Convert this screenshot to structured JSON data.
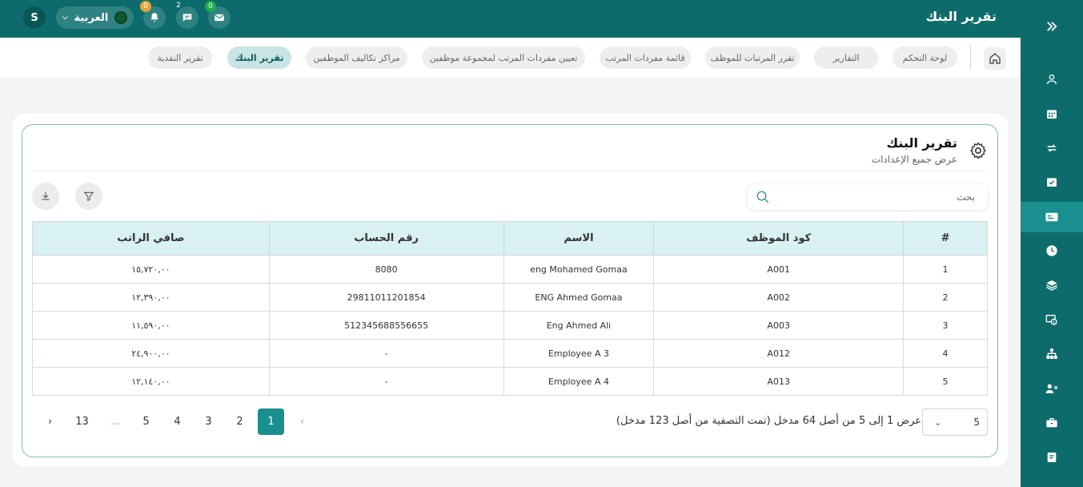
{
  "header": {
    "title": "تقرير البنك",
    "user_initial": "S",
    "language": "العربية",
    "notifications_count": "0",
    "chat_count": "2",
    "mail_count": "0"
  },
  "breadcrumbs": [
    "لوحة التحكم",
    "التقارير",
    "تقرر المرتبات للموظف",
    "قائمة مفردات المرتب",
    "تعيين مفردات المرتب لمجموعة موظفين",
    "مراكز تكاليف الموظفين",
    "تقرير البنك",
    "تقرير النقدية"
  ],
  "card": {
    "title": "تقرير البنك",
    "subtitle": "عرض جميع الإعدادات",
    "search_placeholder": "بحث"
  },
  "table": {
    "headers": [
      "#",
      "كود الموظف",
      "الاسم",
      "رقم الحساب",
      "صافي الراتب"
    ],
    "rows": [
      [
        "1",
        "A001",
        "eng Mohamed Gomaa",
        "8080",
        "١٥,٧٢٠,٠٠"
      ],
      [
        "2",
        "A002",
        "ENG Ahmed Gomaa",
        "29811011201854",
        "١٢,٣٩٠,٠٠"
      ],
      [
        "3",
        "A003",
        "Eng Ahmed Ali",
        "512345688556655",
        "١١,٥٩٠,٠٠"
      ],
      [
        "4",
        "A012",
        "Employee A 3",
        "-",
        "٢٤,٩٠٠,٠٠"
      ],
      [
        "5",
        "A013",
        "Employee A 4",
        "-",
        "١٢,١٤٠,٠٠"
      ]
    ]
  },
  "pagination": {
    "page_size": "5",
    "info": "عرض 1 إلى 5 من أصل 64 مدخل (تمت التصفية من أصل 123 مدخل)",
    "pages": [
      "1",
      "2",
      "3",
      "4",
      "5",
      "...",
      "13"
    ],
    "prev": "‹",
    "next": "›"
  },
  "colors": {
    "primary": "#0e6b6b",
    "accent": "#1a8f8f",
    "table_header": "#d9f1f2"
  },
  "icons": {
    "sidebar": [
      "user-icon",
      "calendar-icon",
      "repeat-icon",
      "calendar-check-icon",
      "id-card-icon",
      "clock-icon",
      "layers-icon",
      "money-icon",
      "org-chart-icon",
      "user-remove-icon",
      "briefcase-icon",
      "document-icon"
    ]
  }
}
